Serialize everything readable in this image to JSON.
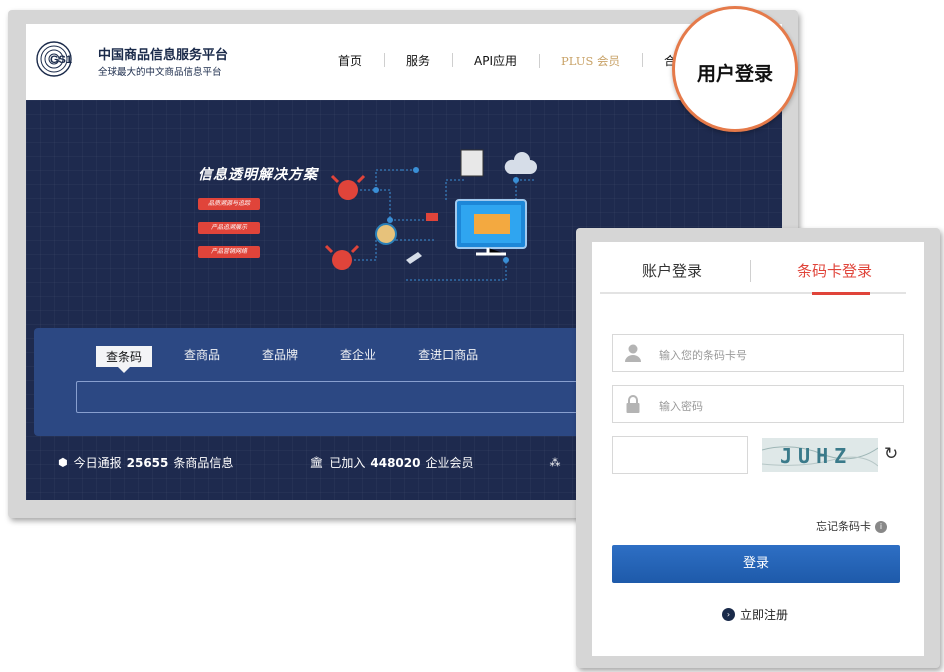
{
  "header": {
    "brand_title": "中国商品信息服务平台",
    "brand_subtitle": "全球最大的中文商品信息平台",
    "logo_text": "GS1",
    "nav": [
      "首页",
      "服务",
      "API应用",
      "PLUS 会员",
      "合作通"
    ]
  },
  "callout": {
    "text": "用户登录"
  },
  "hero": {
    "title": "信息透明解决方案",
    "tags": [
      "品质溯源与追踪",
      "产品追溯展示",
      "产品营销网络"
    ]
  },
  "search": {
    "tabs": [
      "查条码",
      "查商品",
      "查品牌",
      "查企业",
      "查进口商品"
    ],
    "active_tab": 0
  },
  "stats": [
    {
      "icon": "cube-icon",
      "prefix": "今日通报",
      "value": "25655",
      "suffix": "条商品信息"
    },
    {
      "icon": "bank-icon",
      "prefix": "已加入",
      "value": "448020",
      "suffix": "企业会员"
    }
  ],
  "login": {
    "tabs": [
      "账户登录",
      "条码卡登录"
    ],
    "active_tab": 1,
    "card_placeholder": "输入您的条码卡号",
    "password_placeholder": "输入密码",
    "captcha_text": "JUHZ",
    "forgot_label": "忘记条码卡",
    "submit_label": "登录",
    "register_label": "立即注册"
  },
  "colors": {
    "accent": "#e0443a",
    "primary": "#1e5aaa",
    "hero_bg": "#1e2a4e",
    "callout_ring": "#e57a4a"
  }
}
